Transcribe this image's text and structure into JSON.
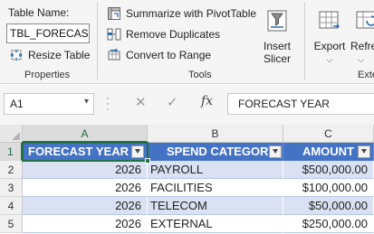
{
  "ribbon": {
    "properties": {
      "table_name_label": "Table Name:",
      "table_name_value": "TBL_FORECAST",
      "resize_label": "Resize Table",
      "group_label": "Properties"
    },
    "tools": {
      "summarize_label": "Summarize with PivotTable",
      "remove_duplicates_label": "Remove Duplicates",
      "convert_label": "Convert to Range",
      "insert_slicer_line1": "Insert",
      "insert_slicer_line2": "Slicer",
      "group_label": "Tools"
    },
    "external": {
      "export_label": "Export",
      "refresh_label": "Refre",
      "group_label": "Exte"
    }
  },
  "formula_bar": {
    "name_box": "A1",
    "cancel_icon": "✕",
    "enter_icon": "✓",
    "fx": "fx",
    "content": "FORECAST YEAR"
  },
  "grid": {
    "columns": [
      "A",
      "B",
      "C"
    ],
    "rows": [
      "1",
      "2",
      "3",
      "4",
      "5"
    ],
    "table": {
      "headers": [
        "FORECAST YEAR",
        "SPEND CATEGORY",
        "AMOUNT"
      ],
      "data": [
        [
          "2026",
          "PAYROLL",
          "$500,000.00"
        ],
        [
          "2026",
          "FACILITIES",
          "$100,000.00"
        ],
        [
          "2026",
          "TELECOM",
          "$50,000.00"
        ],
        [
          "2026",
          "EXTERNAL",
          "$250,000.00"
        ]
      ]
    }
  },
  "colors": {
    "header_blue": "#4472c4",
    "band_blue": "#d9e1f2",
    "selection_green": "#217346"
  }
}
